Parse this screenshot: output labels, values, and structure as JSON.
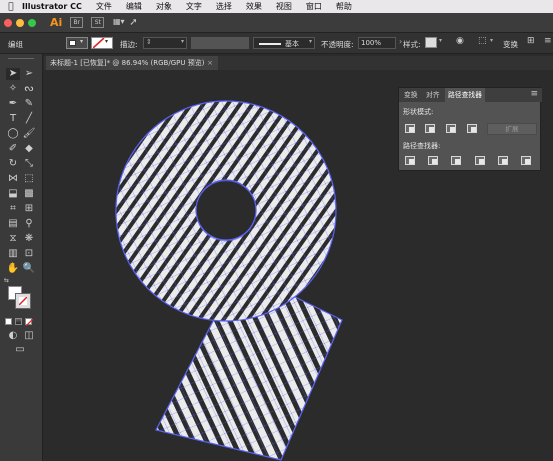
{
  "menubar": {
    "apple": "",
    "app_name": "Illustrator CC",
    "items": [
      "文件",
      "编辑",
      "对象",
      "文字",
      "选择",
      "效果",
      "视图",
      "窗口",
      "帮助"
    ]
  },
  "appbar": {
    "logo": "Ai",
    "btn1": "Br",
    "btn2": "St",
    "traffic_colors": [
      "#fc605c",
      "#fdbc40",
      "#34c84a"
    ]
  },
  "control_bar": {
    "selection_label": "编组",
    "stroke_label": "描边:",
    "stroke_style": "基本",
    "opacity_label": "不透明度:",
    "opacity_value": "100%",
    "style_label": "样式:",
    "transform_btn": "变换"
  },
  "document": {
    "tab_title": "未标题-1 [已恢复]* @ 86.94% (RGB/GPU 预览)",
    "close_glyph": "×"
  },
  "pathfinder_panel": {
    "tabs": [
      "变换",
      "对齐",
      "路径查找器"
    ],
    "active_tab": "路径查找器",
    "shape_modes_label": "形状模式:",
    "expand_button": "扩展",
    "pathfinders_label": "路径查找器:",
    "menu_icon": "≡"
  },
  "colors": {
    "selection": "#5b63f5",
    "fill": "#ebebeb",
    "stripe": "#2b2b2b"
  }
}
